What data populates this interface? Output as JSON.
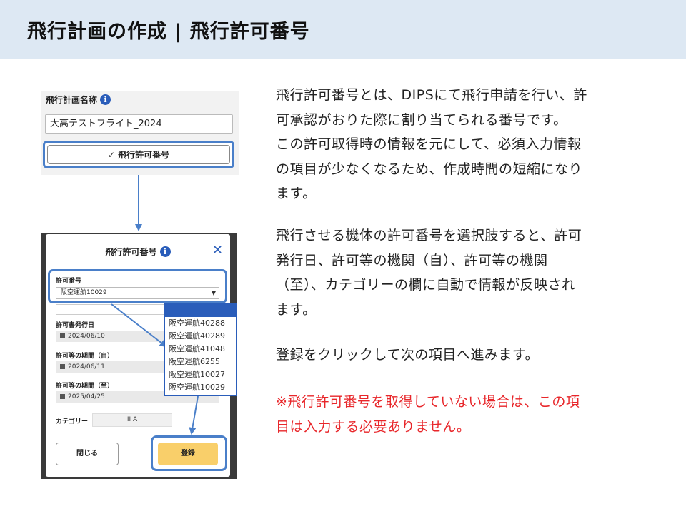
{
  "header": {
    "title": "飛行計画の作成 | 飛行許可番号"
  },
  "top_panel": {
    "field_label": "飛行計画名称",
    "info_icon": "i",
    "name_value": "大高テストフライト_2024",
    "permit_button_label": "✓ 飛行許可番号"
  },
  "dialog": {
    "title": "飛行許可番号",
    "info_icon": "i",
    "close_icon": "✕",
    "permit_label": "許可番号",
    "permit_selected": "阪空運航10029",
    "select_arrow": "▼",
    "issue_date_label": "許可書発行日",
    "issue_date": "2024/06/10",
    "period_from_label": "許可等の期間（自）",
    "period_from": "2024/06/11",
    "period_to_label": "許可等の期間（至）",
    "period_to": "2025/04/25",
    "category_label": "カテゴリー",
    "category_value": "II A",
    "close_button": "閉じる",
    "register_button": "登録"
  },
  "dropdown_options": [
    "阪空運航40288",
    "阪空運航40289",
    "阪空運航41048",
    "阪空運航6255",
    "阪空運航10027",
    "阪空運航10029"
  ],
  "description": {
    "para1": [
      "飛行許可番号とは、DIPSにて飛行申請を行い、許",
      "可承認がおりた際に割り当てられる番号です。",
      "この許可取得時の情報を元にして、必須入力情報",
      "の項目が少なくなるため、作成時間の短縮になり",
      "ます。"
    ],
    "para2": [
      "飛行させる機体の許可番号を選択肢すると、許可",
      "発行日、許可等の機関（自）、許可等の機関",
      "（至）、カテゴリーの欄に自動で情報が反映され",
      "ます。"
    ],
    "para3": [
      "登録をクリックして次の項目へ進みます。"
    ],
    "note": [
      "※飛行許可番号を取得していない場合は、この項",
      "目は入力する必要ありません。"
    ]
  },
  "colors": {
    "header_bg": "#dde8f3",
    "highlight": "#4a7fc9",
    "note_text": "#e8262a",
    "register_bg": "#f9cf6a"
  }
}
